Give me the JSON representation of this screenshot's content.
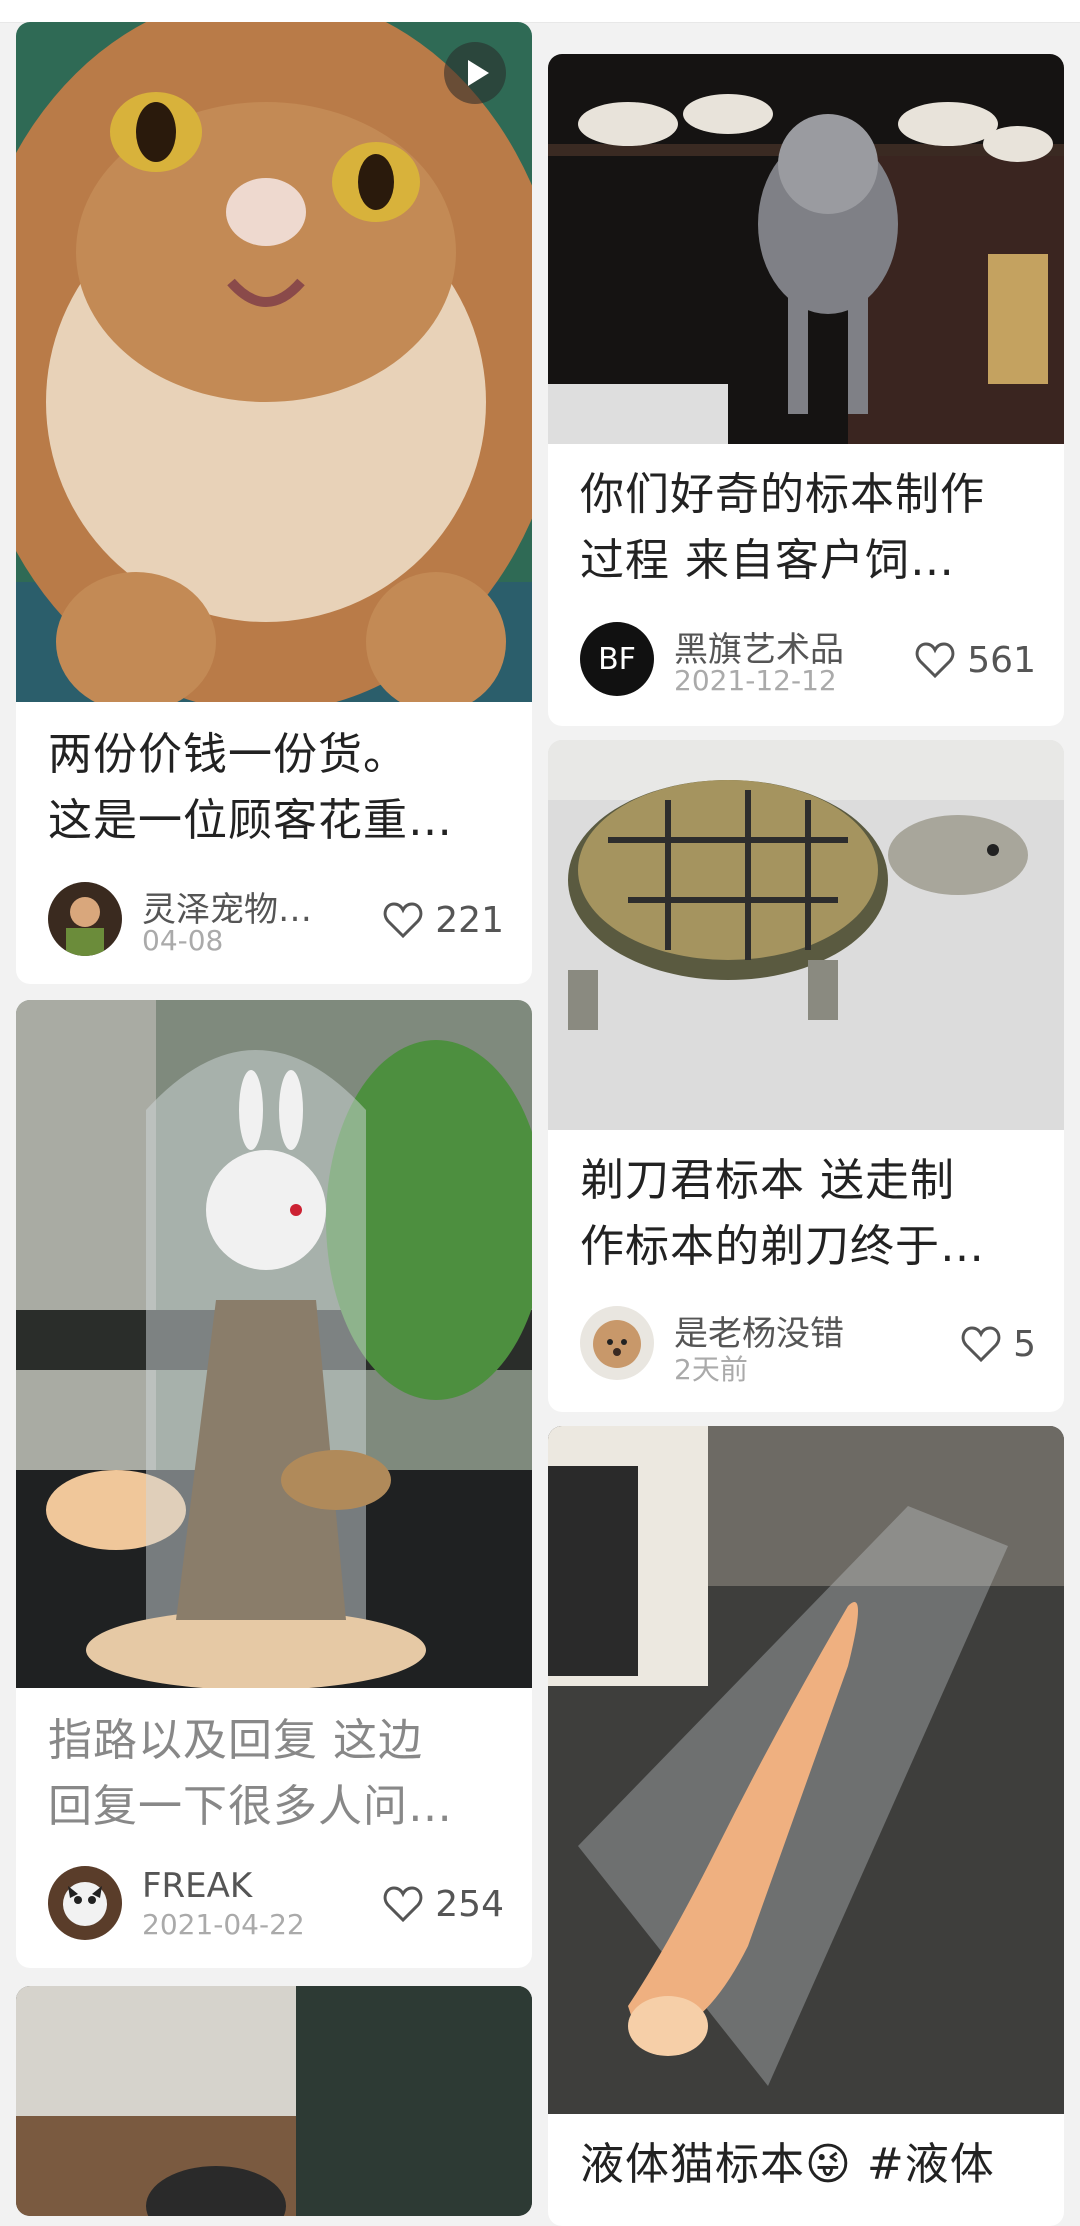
{
  "feed": {
    "left": [
      {
        "title_lines": [
          "两份价钱一份货。",
          "这是一位顾客花重…"
        ],
        "author": "灵泽宠物…",
        "date": "04-08",
        "likes": "221",
        "has_video": true,
        "image": "cat-face-specimen"
      },
      {
        "title_lines": [
          "指路以及回复 这边",
          "回复一下很多人问…"
        ],
        "author": "FREAK",
        "date": "2021-04-22",
        "likes": "254",
        "image": "rabbit-in-glass-dome"
      },
      {
        "image": "partial-next-item"
      }
    ],
    "right": [
      {
        "title_lines": [
          "你们好奇的标本制作",
          "过程 来自客户饲…"
        ],
        "author": "黑旗艺术品",
        "date": "2021-12-12",
        "likes": "561",
        "avatar_text": "BF",
        "image": "grey-cat-specimen-shelf"
      },
      {
        "title_lines": [
          "剃刀君标本 送走制",
          "作标本的剃刀终于…"
        ],
        "author": "是老杨没错",
        "date": "2天前",
        "likes": "5",
        "image": "turtle-specimen"
      },
      {
        "title_lines": [
          "液体猫标本😜 #液体"
        ],
        "image": "liquid-cat-specimen"
      }
    ]
  },
  "colors": {
    "background": "#f2f2f2",
    "card": "#ffffff",
    "title": "#222222",
    "muted": "#aaaaaa"
  }
}
